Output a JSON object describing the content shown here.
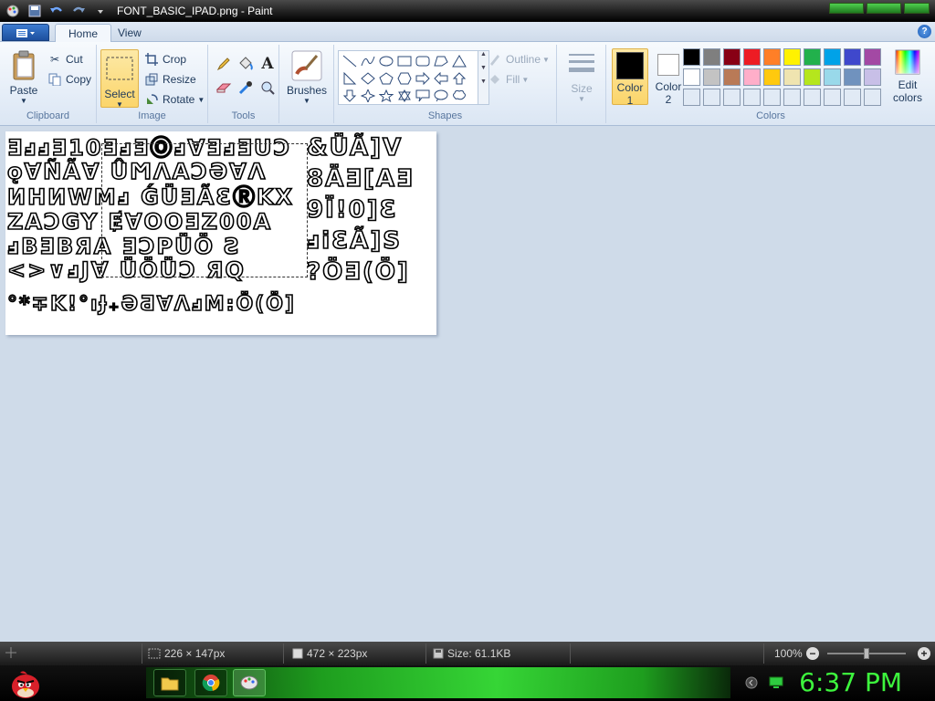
{
  "window": {
    "title": "FONT_BASIC_IPAD.png - Paint"
  },
  "tabs": [
    {
      "label": "Home"
    },
    {
      "label": "View"
    }
  ],
  "help_label": "?",
  "clipboard": {
    "group_label": "Clipboard",
    "paste_label": "Paste",
    "cut_label": "Cut",
    "copy_label": "Copy"
  },
  "image_group": {
    "group_label": "Image",
    "select_label": "Select",
    "crop_label": "Crop",
    "resize_label": "Resize",
    "rotate_label": "Rotate"
  },
  "tools": {
    "group_label": "Tools",
    "text_tool_glyph": "A"
  },
  "brushes": {
    "label": "Brushes"
  },
  "shapes": {
    "group_label": "Shapes",
    "outline_label": "Outline",
    "fill_label": "Fill"
  },
  "size": {
    "label": "Size"
  },
  "colors": {
    "group_label": "Colors",
    "color1_label": "Color",
    "color1_num": "1",
    "color2_label": "Color",
    "color2_num": "2",
    "edit_label_1": "Edit",
    "edit_label_2": "colors",
    "color1_value": "#000000",
    "color2_value": "#ffffff",
    "palette_row1": [
      "#000000",
      "#7f7f7f",
      "#880015",
      "#ed1c24",
      "#ff7f27",
      "#fff200",
      "#22b14c",
      "#00a2e8",
      "#3f48cc",
      "#a349a4"
    ],
    "palette_row2": [
      "#ffffff",
      "#c3c3c3",
      "#b97a57",
      "#ffaec9",
      "#ffc90e",
      "#efe4b0",
      "#b5e61d",
      "#99d9ea",
      "#7092be",
      "#c8bfe7"
    ],
    "palette_row3": [
      "#e1eaf5",
      "#e1eaf5",
      "#e1eaf5",
      "#e1eaf5",
      "#e1eaf5",
      "#e1eaf5",
      "#e1eaf5",
      "#e1eaf5",
      "#e1eaf5",
      "#e1eaf5"
    ]
  },
  "canvas": {
    "rows": [
      "ƎⅎⅎƎ10ƎⅎƎⓄⅎ∀ƎⅎƎUƆ",
      "ǫ∀ÑÃ∀  ÛϺɅAƆƏ∀Ʌ",
      "ИHИWMⅎ ǴÜƎÃƐⓇKX",
      "ZAƆGY ɆⱯOOƎZ00A",
      "ⅎBƎBЯA  ƎƆPÜÖ Ƨ",
      "<>∨ⅎJ∀  ÜÖÜƆ ЯQ"
    ],
    "right_glyphs": "&ÜÃ]V 8ÄƎ[AƎ 9Ï!0]Ɛ ⅎiƐÃ]S ?ÖƎ(Ö]",
    "bottom_glyphs": "°*∓K!°ıɈ₊ƏƋ∀ɅⅎM:Ö(Ö]"
  },
  "status": {
    "selection_size": "226 × 147px",
    "image_size": "472 × 223px",
    "file_size": "Size: 61.1KB",
    "zoom": "100%"
  },
  "taskbar": {
    "clock": "6:37 PM"
  }
}
